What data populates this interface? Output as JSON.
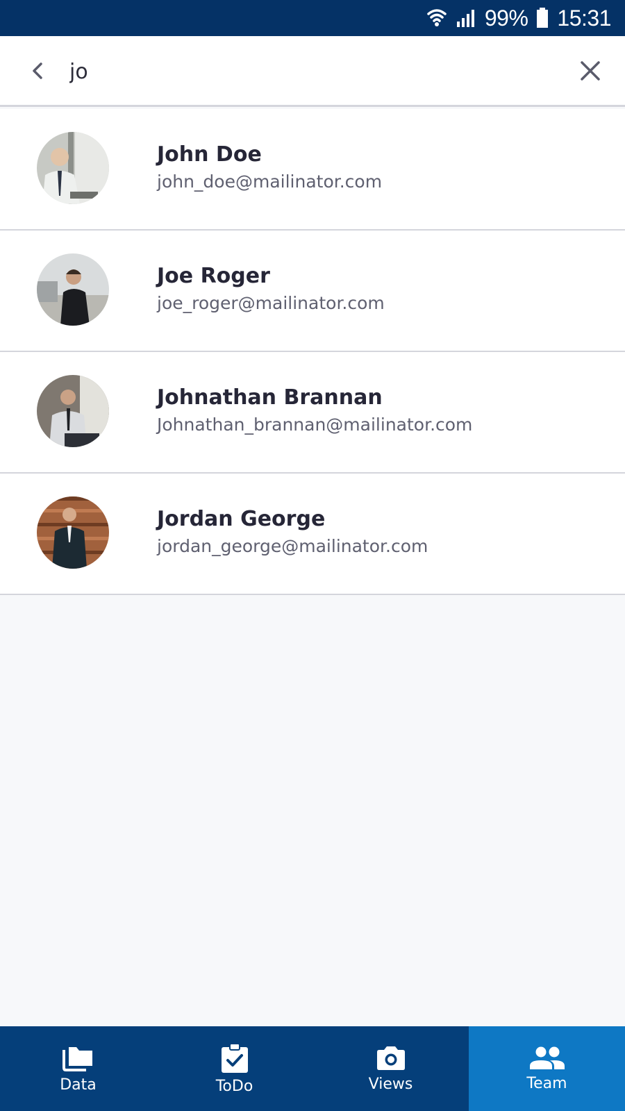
{
  "status_bar": {
    "battery": "99%",
    "time": "15:31",
    "icons": [
      "wifi-icon",
      "signal-icon",
      "battery-icon"
    ]
  },
  "search": {
    "query": "jo",
    "back_icon": "chevron-left-icon",
    "clear_icon": "close-icon"
  },
  "results": [
    {
      "name": "John Doe",
      "email": "john_doe@mailinator.com"
    },
    {
      "name": "Joe Roger",
      "email": "joe_roger@mailinator.com"
    },
    {
      "name": "Johnathan Brannan",
      "email": "Johnathan_brannan@mailinator.com"
    },
    {
      "name": "Jordan George",
      "email": "jordan_george@mailinator.com"
    }
  ],
  "bottom_nav": {
    "items": [
      {
        "label": "Data",
        "icon": "folder-icon"
      },
      {
        "label": "ToDo",
        "icon": "clipboard-check-icon"
      },
      {
        "label": "Views",
        "icon": "camera-icon"
      },
      {
        "label": "Team",
        "icon": "people-icon"
      }
    ],
    "active_index": 3
  },
  "colors": {
    "status_bar": "#053266",
    "nav_bg": "#053f7a",
    "nav_active": "#0e78c4",
    "divider": "#d4d5dc"
  }
}
